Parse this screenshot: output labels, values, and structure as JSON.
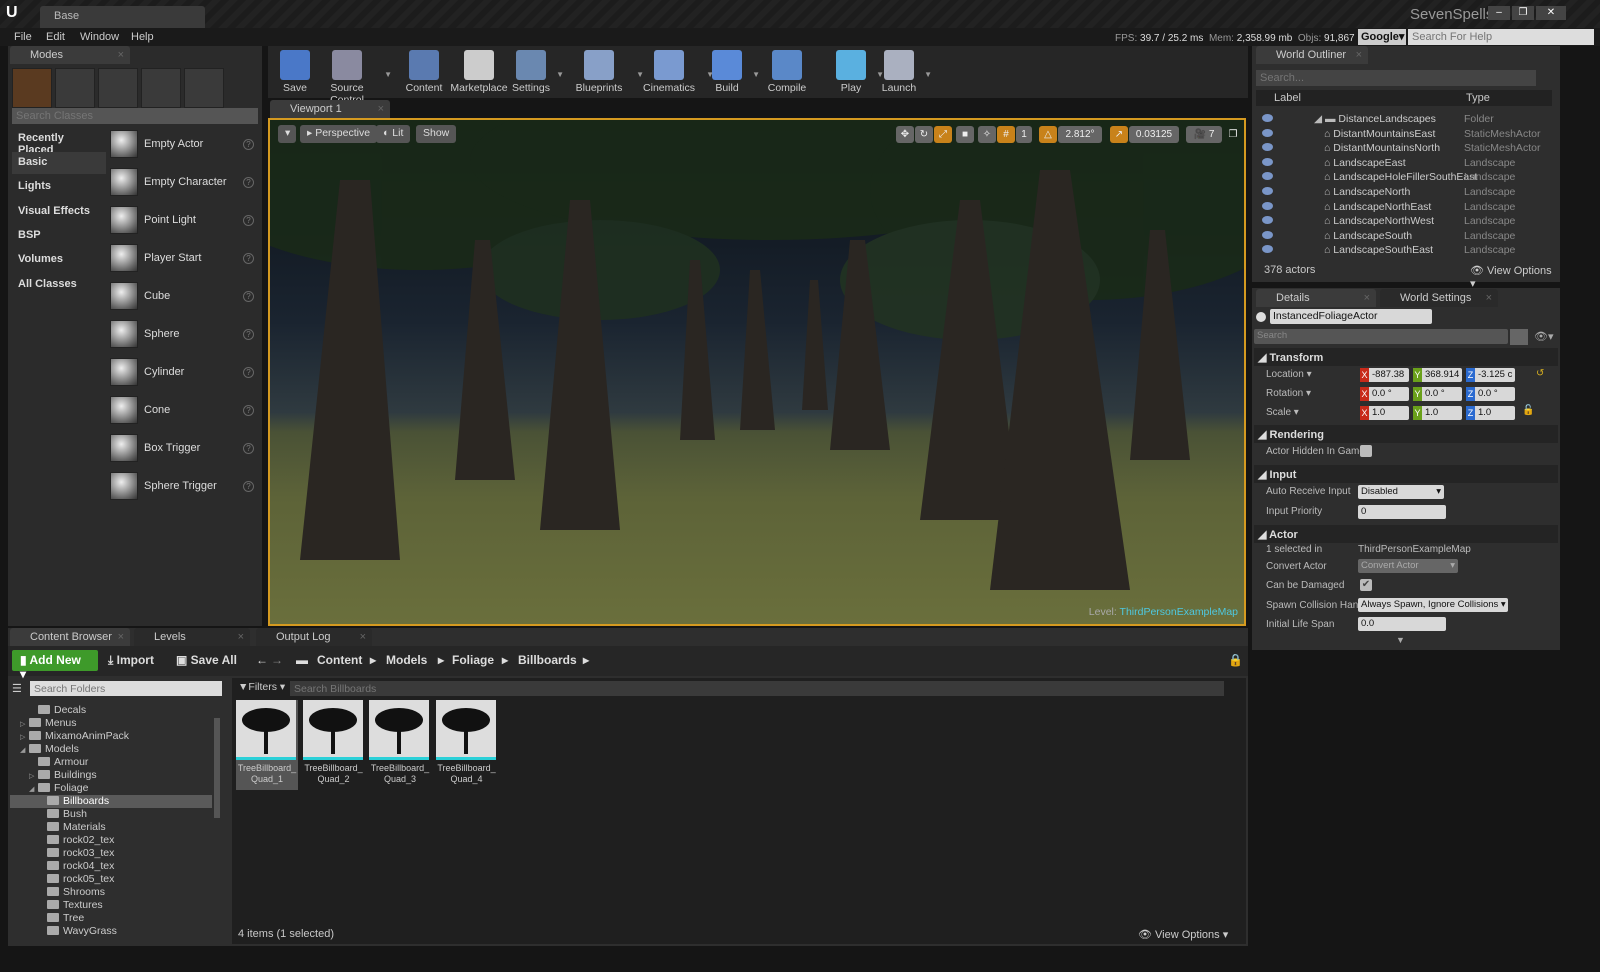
{
  "window": {
    "doc_tab": "Base",
    "project": "SevenSpells",
    "minimize": "–",
    "maximize": "❐",
    "close": "✕"
  },
  "menu": [
    "File",
    "Edit",
    "Window",
    "Help"
  ],
  "stats": {
    "fps_label": "FPS:",
    "fps": "39.7 / 25.2 ms",
    "mem_label": "Mem:",
    "mem": "2,358.99 mb",
    "objs_label": "Objs:",
    "objs": "91,867"
  },
  "help": {
    "engine": "Google",
    "placeholder": "Search For Help"
  },
  "modes": {
    "tab": "Modes",
    "search_placeholder": "Search Classes",
    "categories": [
      "Recently Placed",
      "Basic",
      "Lights",
      "Visual Effects",
      "BSP",
      "Volumes",
      "All Classes"
    ],
    "active_category": "Basic",
    "items": [
      "Empty Actor",
      "Empty Character",
      "Point Light",
      "Player Start",
      "Cube",
      "Sphere",
      "Cylinder",
      "Cone",
      "Box Trigger",
      "Sphere Trigger"
    ]
  },
  "toolbar": [
    "Save",
    "Source Control",
    "Content",
    "Marketplace",
    "Settings",
    "Blueprints",
    "Cinematics",
    "Build",
    "Compile",
    "Play",
    "Launch"
  ],
  "viewport": {
    "tab": "Viewport 1",
    "perspective": "Perspective",
    "lit": "Lit",
    "show": "Show",
    "grid_snap": "1",
    "rot_snap": "2.812°",
    "scale_snap": "0.03125",
    "cam_speed": "7",
    "level_label": "Level:",
    "level": "ThirdPersonExampleMap"
  },
  "outliner": {
    "tab": "World Outliner",
    "search_placeholder": "Search...",
    "col_label": "Label",
    "col_type": "Type",
    "rows": [
      {
        "name": "DistanceLandscapes",
        "type": "Folder",
        "indent": 1
      },
      {
        "name": "DistantMountainsEast",
        "type": "StaticMeshActor",
        "indent": 2
      },
      {
        "name": "DistantMountainsNorth",
        "type": "StaticMeshActor",
        "indent": 2
      },
      {
        "name": "LandscapeEast",
        "type": "Landscape",
        "indent": 2
      },
      {
        "name": "LandscapeHoleFillerSouthEast",
        "type": "Landscape",
        "indent": 2
      },
      {
        "name": "LandscapeNorth",
        "type": "Landscape",
        "indent": 2
      },
      {
        "name": "LandscapeNorthEast",
        "type": "Landscape",
        "indent": 2
      },
      {
        "name": "LandscapeNorthWest",
        "type": "Landscape",
        "indent": 2
      },
      {
        "name": "LandscapeSouth",
        "type": "Landscape",
        "indent": 2
      },
      {
        "name": "LandscapeSouthEast",
        "type": "Landscape",
        "indent": 2
      }
    ],
    "count": "378 actors",
    "view_options": "View Options"
  },
  "details": {
    "tab": "Details",
    "tab2": "World Settings",
    "actor_name": "InstancedFoliageActor",
    "search_placeholder": "Search",
    "transform": {
      "title": "Transform",
      "location_label": "Location",
      "rotation_label": "Rotation",
      "scale_label": "Scale",
      "location": [
        "-887.38",
        "368.914",
        "-3.125 c"
      ],
      "rotation": [
        "0.0 °",
        "0.0 °",
        "0.0 °"
      ],
      "scale": [
        "1.0",
        "1.0",
        "1.0"
      ]
    },
    "rendering": {
      "title": "Rendering",
      "hidden_label": "Actor Hidden In Game",
      "hidden": false
    },
    "input": {
      "title": "Input",
      "auto_label": "Auto Receive Input",
      "auto": "Disabled",
      "priority_label": "Input Priority",
      "priority": "0"
    },
    "actor": {
      "title": "Actor",
      "selected_label": "1 selected in",
      "selected": "ThirdPersonExampleMap",
      "convert_label": "Convert Actor",
      "convert": "Convert Actor",
      "damaged_label": "Can be Damaged",
      "damaged": true,
      "spawn_label": "Spawn Collision Hand",
      "spawn": "Always Spawn, Ignore Collisions",
      "life_label": "Initial Life Span",
      "life": "0.0"
    }
  },
  "content_browser": {
    "tabs": [
      "Content Browser",
      "Levels",
      "Output Log"
    ],
    "add_new": "Add New",
    "import": "Import",
    "save_all": "Save All",
    "path": [
      "Content",
      "Models",
      "Foliage",
      "Billboards"
    ],
    "folder_search": "Search Folders",
    "filters": "Filters",
    "asset_search": "Search Billboards",
    "folders": [
      {
        "name": "Decals",
        "depth": 1,
        "arrow": ""
      },
      {
        "name": "Menus",
        "depth": 0,
        "arrow": "▷"
      },
      {
        "name": "MixamoAnimPack",
        "depth": 0,
        "arrow": "▷"
      },
      {
        "name": "Models",
        "depth": 0,
        "arrow": "◢"
      },
      {
        "name": "Armour",
        "depth": 1,
        "arrow": ""
      },
      {
        "name": "Buildings",
        "depth": 1,
        "arrow": "▷"
      },
      {
        "name": "Foliage",
        "depth": 1,
        "arrow": "◢"
      },
      {
        "name": "Billboards",
        "depth": 2,
        "arrow": "",
        "selected": true
      },
      {
        "name": "Bush",
        "depth": 2,
        "arrow": ""
      },
      {
        "name": "Materials",
        "depth": 2,
        "arrow": ""
      },
      {
        "name": "rock02_tex",
        "depth": 2,
        "arrow": ""
      },
      {
        "name": "rock03_tex",
        "depth": 2,
        "arrow": ""
      },
      {
        "name": "rock04_tex",
        "depth": 2,
        "arrow": ""
      },
      {
        "name": "rock05_tex",
        "depth": 2,
        "arrow": ""
      },
      {
        "name": "Shrooms",
        "depth": 2,
        "arrow": ""
      },
      {
        "name": "Textures",
        "depth": 2,
        "arrow": ""
      },
      {
        "name": "Tree",
        "depth": 2,
        "arrow": ""
      },
      {
        "name": "WavyGrass",
        "depth": 2,
        "arrow": ""
      }
    ],
    "assets": [
      "TreeBillboard_ Quad_1",
      "TreeBillboard_ Quad_2",
      "TreeBillboard_ Quad_3",
      "TreeBillboard_ Quad_4"
    ],
    "status": "4 items (1 selected)",
    "view_options": "View Options"
  },
  "colors": {
    "accent_orange": "#d59a20",
    "add_new_green": "#3e9a2a",
    "selection_cyan": "#2ad0d8",
    "level_link": "#4ec8e0"
  }
}
